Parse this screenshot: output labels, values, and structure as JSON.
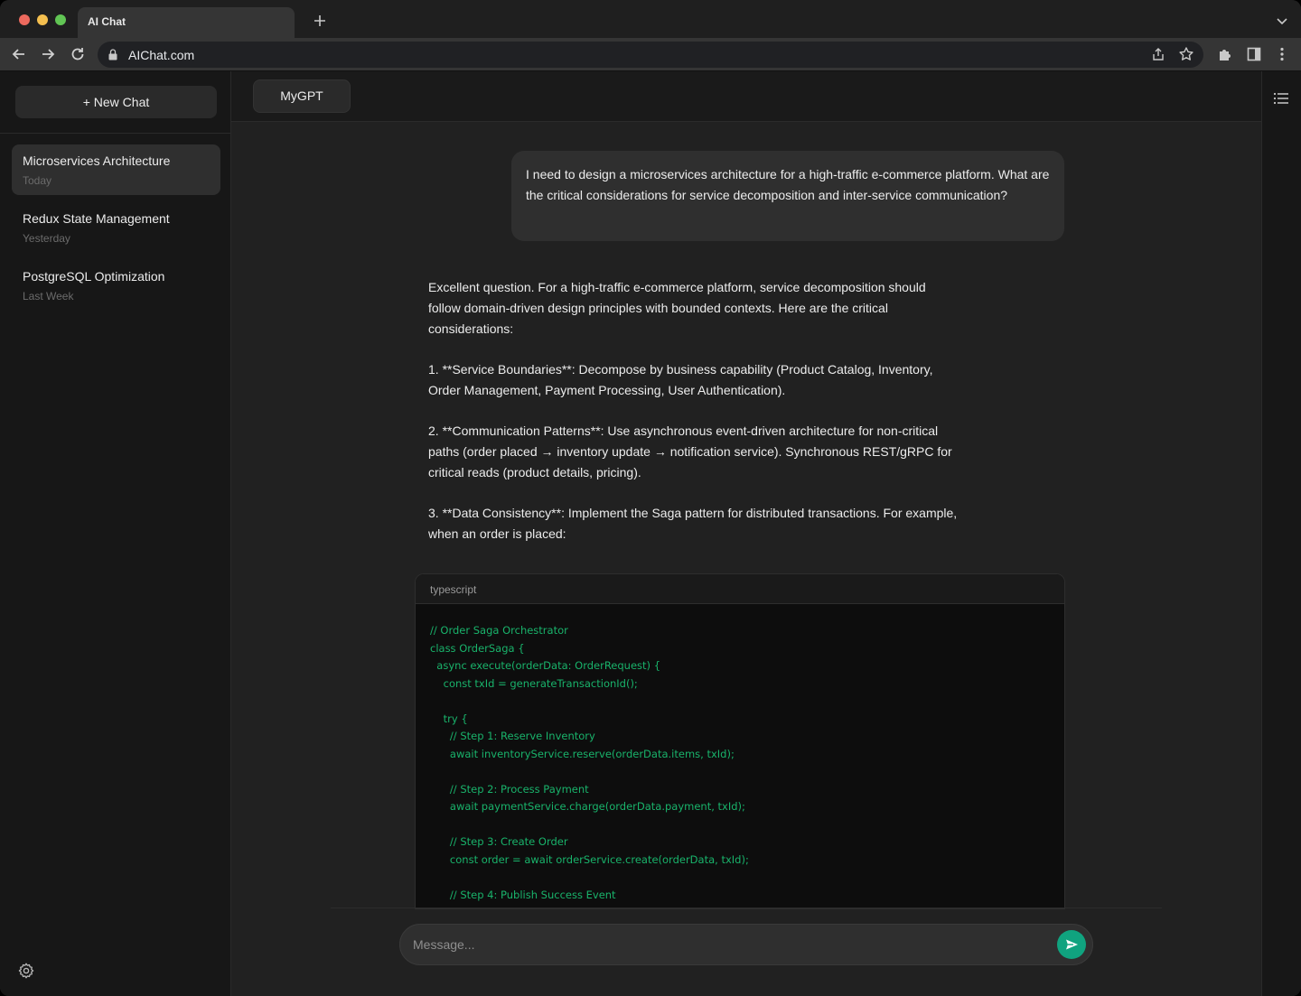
{
  "browser": {
    "tab_title": "AI Chat",
    "url": "AIChat.com"
  },
  "sidebar": {
    "new_chat_label": "+ New Chat",
    "chats": [
      {
        "title": "Microservices Architecture",
        "date": "Today"
      },
      {
        "title": "Redux State Management",
        "date": "Yesterday"
      },
      {
        "title": "PostgreSQL Optimization",
        "date": "Last Week"
      }
    ]
  },
  "header": {
    "model_label": "MyGPT"
  },
  "conversation": {
    "user_message": "I need to design a microservices architecture for a high-traffic e-commerce platform. What are the critical considerations for service decomposition and inter-service communication?",
    "assistant_paragraphs": [
      "Excellent question. For a high-traffic e-commerce platform, service decomposition should follow domain-driven design principles with bounded contexts. Here are the critical considerations:",
      "1. **Service Boundaries**: Decompose by business capability (Product Catalog, Inventory, Order Management, Payment Processing, User Authentication).",
      "2. **Communication Patterns**: Use asynchronous event-driven architecture for non-critical paths (order placed → inventory update → notification service). Synchronous REST/gRPC for critical reads (product details, pricing).",
      "3. **Data Consistency**: Implement the Saga pattern for distributed transactions. For example, when an order is placed:"
    ],
    "code": {
      "language": "typescript",
      "text": "// Order Saga Orchestrator\nclass OrderSaga {\n  async execute(orderData: OrderRequest) {\n    const txId = generateTransactionId();\n\n    try {\n      // Step 1: Reserve Inventory\n      await inventoryService.reserve(orderData.items, txId);\n\n      // Step 2: Process Payment\n      await paymentService.charge(orderData.payment, txId);\n\n      // Step 3: Create Order\n      const order = await orderService.create(orderData, txId);\n\n      // Step 4: Publish Success Event"
    }
  },
  "composer": {
    "placeholder": "Message..."
  },
  "icons": {
    "back": "arrow-left-icon",
    "forward": "arrow-right-icon",
    "reload": "reload-icon",
    "lock": "lock-icon",
    "share": "share-icon",
    "bookmark": "star-icon",
    "extensions": "puzzle-icon",
    "side_panel": "side-panel-icon",
    "menu": "kebab-menu-icon",
    "settings": "gear-icon",
    "send": "send-icon",
    "outline": "list-icon"
  },
  "colors": {
    "accent": "#10a37f",
    "code_text": "#19b36b",
    "background": "#212121",
    "sidebar": "#171717"
  }
}
